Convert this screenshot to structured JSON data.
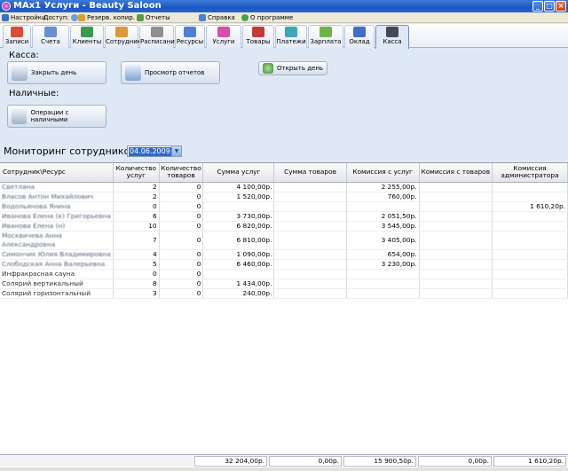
{
  "window": {
    "title": "MAx1 Услуги - Beauty Saloon",
    "min": "_",
    "max": "□",
    "close": "×"
  },
  "menu": {
    "settings": "Настройки",
    "access": "Доступ:",
    "backup": "Резерв. копир.",
    "reports": "Отчеты",
    "help": "Справка",
    "about": "О программе"
  },
  "tabs": [
    {
      "label": "Записи",
      "color": "#d84d3a"
    },
    {
      "label": "Счета",
      "color": "#6b8fd1"
    },
    {
      "label": "Клиенты",
      "color": "#3a9a4b"
    },
    {
      "label": "Сотрудники",
      "color": "#d99a37"
    },
    {
      "label": "Расписание",
      "color": "#8f8f8f"
    },
    {
      "label": "Ресурсы",
      "color": "#4f7fd0"
    },
    {
      "label": "Услуги",
      "color": "#d64ea6"
    },
    {
      "label": "Товары",
      "color": "#c23b3b"
    },
    {
      "label": "Платежи",
      "color": "#3ea7b5"
    },
    {
      "label": "Зарплата",
      "color": "#6fb34a"
    },
    {
      "label": "Оклад",
      "color": "#3d6fc7"
    },
    {
      "label": "Касса",
      "color": "#444a55"
    }
  ],
  "kassa": {
    "heading": "Касса:",
    "close_day": "Закрыть день",
    "view_reports": "Просмотр отчетов",
    "open_day": "Открыть день",
    "cash_heading": "Наличные:",
    "cash_ops": "Операции с наличными"
  },
  "monitor": {
    "label": "Мониторинг сотрудников:",
    "date": "04.06.2009"
  },
  "columns": [
    "Сотрудник\\Ресурс",
    "Количество услуг",
    "Количество товаров",
    "Сумма услуг",
    "Сумма товаров",
    "Комиссия с услуг",
    "Комиссия с товаров",
    "Комиссия администратора"
  ],
  "rows": [
    {
      "name": "Светлана",
      "qs": "2",
      "qg": "0",
      "ss": "4 100,00р.",
      "sg": "",
      "cs": "2 255,00р.",
      "cg": "",
      "ca": ""
    },
    {
      "name": "Власов Антон Михайлович",
      "qs": "2",
      "qg": "0",
      "ss": "1 520,00р.",
      "sg": "",
      "cs": "760,00р.",
      "cg": "",
      "ca": ""
    },
    {
      "name": "Водольянова Янина",
      "qs": "0",
      "qg": "0",
      "ss": "",
      "sg": "",
      "cs": "",
      "cg": "",
      "ca": "1 610,20р."
    },
    {
      "name": "Иванова Елена (к) Григорьевна",
      "qs": "6",
      "qg": "0",
      "ss": "3 730,00р.",
      "sg": "",
      "cs": "2 051,50р.",
      "cg": "",
      "ca": ""
    },
    {
      "name": "Иванова Елена (н)",
      "qs": "10",
      "qg": "0",
      "ss": "6 820,00р.",
      "sg": "",
      "cs": "3 545,00р.",
      "cg": "",
      "ca": ""
    },
    {
      "name": "Москвичева Анна Александровна",
      "qs": "7",
      "qg": "0",
      "ss": "6 810,00р.",
      "sg": "",
      "cs": "3 405,00р.",
      "cg": "",
      "ca": ""
    },
    {
      "name": "Симончик Юлия Владимировна",
      "qs": "4",
      "qg": "0",
      "ss": "1 090,00р.",
      "sg": "",
      "cs": "654,00р.",
      "cg": "",
      "ca": ""
    },
    {
      "name": "Слободская Анна Валерьевна",
      "qs": "5",
      "qg": "0",
      "ss": "6 460,00р.",
      "sg": "",
      "cs": "3 230,00р.",
      "cg": "",
      "ca": ""
    },
    {
      "name": "Инфракрасная сауна",
      "qs": "0",
      "qg": "0",
      "ss": "",
      "sg": "",
      "cs": "",
      "cg": "",
      "ca": ""
    },
    {
      "name": "Солярий вертикальный",
      "qs": "8",
      "qg": "0",
      "ss": "1 434,00р.",
      "sg": "",
      "cs": "",
      "cg": "",
      "ca": ""
    },
    {
      "name": "Солярий горизонтальный",
      "qs": "3",
      "qg": "0",
      "ss": "240,00р.",
      "sg": "",
      "cs": "",
      "cg": "",
      "ca": ""
    }
  ],
  "totals": {
    "ss": "32 204,00р.",
    "sg": "0,00р.",
    "cs": "15 900,50р.",
    "cg": "0,00р.",
    "ca": "1 610,20р."
  }
}
